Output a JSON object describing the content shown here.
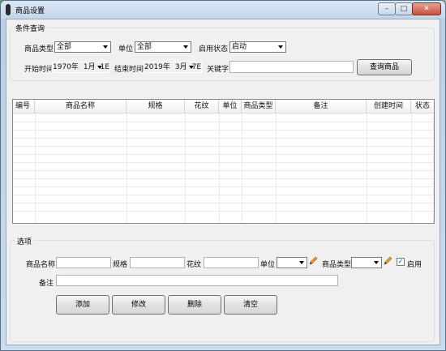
{
  "window": {
    "title": "商品设置",
    "min_glyph": "–",
    "max_glyph": "□",
    "close_glyph": "✕"
  },
  "query": {
    "legend": "条件查询",
    "category_label": "商品类型",
    "category_value": "全部",
    "unit_label": "单位",
    "unit_value": "全部",
    "status_label": "启用状态",
    "status_value": "启动",
    "start_label": "开始时间",
    "start_year": "1970年",
    "start_month": "1月",
    "start_day": "1E",
    "end_label": "结束时间",
    "end_year": "2019年",
    "end_month": "3月",
    "end_day": "7E",
    "keyword_label": "关键字",
    "keyword_value": "",
    "search_button": "查询商品"
  },
  "grid": {
    "columns": [
      "编号",
      "商品名称",
      "规格",
      "花纹",
      "单位",
      "商品类型",
      "备注",
      "创建时间",
      "状态"
    ],
    "rows": []
  },
  "options": {
    "legend": "选项",
    "name_label": "商品名称",
    "name_value": "",
    "spec_label": "规格",
    "spec_value": "",
    "pattern_label": "花纹",
    "pattern_value": "",
    "unit_label": "单位",
    "unit_value": "",
    "category_label": "商品类型",
    "category_value": "",
    "enable_label": "启用",
    "enable_checked": "✓",
    "remark_label": "备注",
    "remark_value": "",
    "add_button": "添加",
    "edit_button": "修改",
    "delete_button": "删除",
    "clear_button": "清空"
  }
}
